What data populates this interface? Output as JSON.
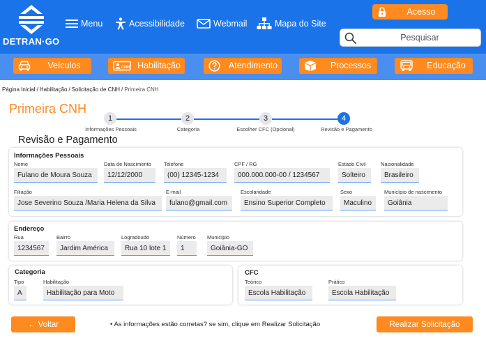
{
  "header": {
    "logo_text": "DETRAN·GO",
    "topnav": {
      "menu": "Menu",
      "accessibility": "Acessibilidade",
      "webmail": "Webmail",
      "sitemap": "Mapa do Site"
    },
    "login_label": "Acesso",
    "search_placeholder": "Pesquisar"
  },
  "mainnav": {
    "items": [
      {
        "label": "Veículos",
        "icon": "car-icon"
      },
      {
        "label": "Habilitação",
        "icon": "license-card-icon"
      },
      {
        "label": "Atendimento",
        "icon": "question-icon"
      },
      {
        "label": "Processos",
        "icon": "box-icon"
      },
      {
        "label": "Educação",
        "icon": "school-bus-icon"
      }
    ]
  },
  "breadcrumb": {
    "items": [
      "Página Inicial",
      "Habilitação",
      "Solicitação de CNH"
    ],
    "current": "Primeira CNH"
  },
  "page": {
    "title": "Primeira CNH",
    "section_title": "Revisão e Pagamento"
  },
  "stepper": {
    "steps": [
      {
        "number": "1",
        "label": "Informações Pessoais"
      },
      {
        "number": "2",
        "label": "Categoria"
      },
      {
        "number": "3",
        "label": "Escolher CFC (Opcional)"
      },
      {
        "number": "4",
        "label": "Revisão e Pagamento"
      }
    ],
    "active_step": 4
  },
  "personal": {
    "title": "Informações Pessoais",
    "nome": {
      "label": "Nome",
      "value": "Fulano de Moura Souza"
    },
    "nascimento": {
      "label": "Data de Nascimento",
      "value": "12/12/2000"
    },
    "telefone": {
      "label": "Telefone",
      "value": "(00) 12345-1234"
    },
    "cpf": {
      "label": "CPF / RG",
      "value": "000.000.000-00 / 1234567"
    },
    "estado_civil": {
      "label": "Estado Civil",
      "value": "Solteiro"
    },
    "nacionalidade": {
      "label": "Nacionalidade",
      "value": "Brasileiro"
    },
    "filiacao": {
      "label": "Filiação",
      "value": "Jose Severino Souza /Maria Helena da Silva"
    },
    "email": {
      "label": "E-mail",
      "value": "fulano@gmail.com"
    },
    "escolaridade": {
      "label": "Escolaridade",
      "value": "Ensino Superior Completo"
    },
    "sexo": {
      "label": "Sexo",
      "value": "Maculino"
    },
    "municipio_nasc": {
      "label": "Município de nascimento",
      "value": "Goiânia"
    }
  },
  "address": {
    "title": "Endereço",
    "rua": {
      "label": "Rua",
      "value": "1234567"
    },
    "bairro": {
      "label": "Bairro",
      "value": "Jardim América"
    },
    "logradouro": {
      "label": "Logradoudo",
      "value": "Rua 10 lote 1"
    },
    "numero": {
      "label": "Número",
      "value": "1"
    },
    "municipio": {
      "label": "Município",
      "value": "Goiânia-GO"
    }
  },
  "category": {
    "title": "Categoria",
    "tipo": {
      "label": "Tipo",
      "value": "A"
    },
    "habilitacao": {
      "label": "Habilitação",
      "value": "Habilitação para Moto"
    }
  },
  "cfc": {
    "title": "CFC",
    "teorico": {
      "label": "Teórico",
      "value": "Escola Habilitação"
    },
    "pratico": {
      "label": "Prático",
      "value": "Escola Habilitação"
    }
  },
  "footer": {
    "back_label": "← Voltar",
    "note": "• As informações estão corretas? se sim, clique em Realizar Solicitação",
    "submit_label": "Realizar Solicitação"
  },
  "colors": {
    "primary": "#1a73e8",
    "nav_bar": "#4a8ff0",
    "accent": "#ff8a1f"
  }
}
